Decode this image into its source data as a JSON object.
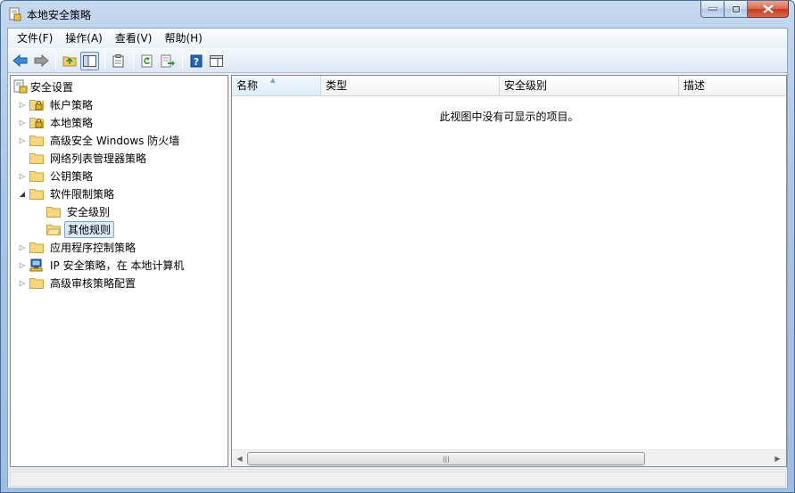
{
  "window": {
    "title": "本地安全策略"
  },
  "menu": [
    {
      "label": "文件(F)"
    },
    {
      "label": "操作(A)"
    },
    {
      "label": "查看(V)"
    },
    {
      "label": "帮助(H)"
    }
  ],
  "toolbar": {
    "icons": [
      "back-arrow-icon",
      "forward-arrow-icon",
      "up-folder-icon",
      "show-hide-tree-icon",
      "properties-icon",
      "refresh-icon",
      "export-list-icon",
      "help-icon",
      "action-pane-icon"
    ]
  },
  "tree": {
    "root": "安全设置",
    "items": [
      {
        "label": "帐户策略",
        "icon": "lock-folder-icon",
        "expander": "collapsed"
      },
      {
        "label": "本地策略",
        "icon": "lock-folder-icon",
        "expander": "collapsed"
      },
      {
        "label": "高级安全 Windows 防火墙",
        "icon": "folder-icon",
        "expander": "collapsed"
      },
      {
        "label": "网络列表管理器策略",
        "icon": "folder-icon",
        "expander": "none"
      },
      {
        "label": "公钥策略",
        "icon": "folder-icon",
        "expander": "collapsed"
      },
      {
        "label": "软件限制策略",
        "icon": "folder-icon",
        "expander": "expanded"
      },
      {
        "label": "安全级别",
        "icon": "folder-icon",
        "child": true
      },
      {
        "label": "其他规则",
        "icon": "folder-icon",
        "child": true,
        "selected": true
      },
      {
        "label": "应用程序控制策略",
        "icon": "folder-icon",
        "expander": "collapsed"
      },
      {
        "label": "IP 安全策略，在 本地计算机",
        "icon": "ip-security-icon",
        "expander": "collapsed"
      },
      {
        "label": "高级审核策略配置",
        "icon": "folder-icon",
        "expander": "collapsed"
      }
    ]
  },
  "list": {
    "columns": [
      "名称",
      "类型",
      "安全级别",
      "描述"
    ],
    "empty_message": "此视图中没有可显示的项目。"
  },
  "colors": {
    "accent": "#3a6ea5",
    "selected_bg": "#dcebfc",
    "folder": "#f5d782"
  }
}
